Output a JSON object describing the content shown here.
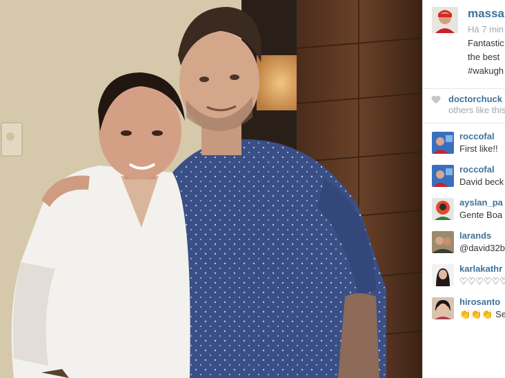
{
  "post": {
    "username": "massa",
    "time": "Há 7 min",
    "caption_lines": [
      "Fantastic",
      "the best",
      "#wakugh"
    ]
  },
  "likes": {
    "liker": "doctorchuck",
    "others": "others like this"
  },
  "comments": [
    {
      "user": "roccofal",
      "text": "First like!!"
    },
    {
      "user": "roccofal",
      "text": "David beck"
    },
    {
      "user": "ayslan_pa",
      "text": "Gente Boa"
    },
    {
      "user": "larands",
      "text": "@david32b"
    },
    {
      "user": "karlakathr",
      "text": "♡♡♡♡♡♡♡"
    },
    {
      "user": "hirosanto",
      "text": "👏👏👏 See"
    }
  ],
  "colors": {
    "username_blue": "#3f729b",
    "muted_gray": "#a5a7aa",
    "text": "#333333"
  }
}
